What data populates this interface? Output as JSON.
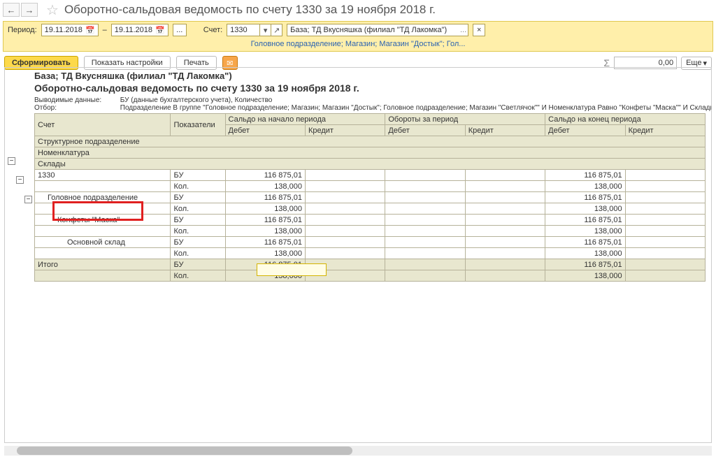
{
  "header": {
    "page_title": "Оборотно-сальдовая ведомость по счету 1330  за 19 ноября 2018 г."
  },
  "filters": {
    "period_label": "Период:",
    "date_from": "19.11.2018",
    "date_to": "19.11.2018",
    "dash": "–",
    "ellipsis": "...",
    "account_label": "Счет:",
    "account_value": "1330",
    "org_value": "База; ТД Вкусняшка (филиал \"ТД Лакомка\")",
    "x": "×",
    "sub_link": "Головное подразделение; Магазин; Магазин \"Достык\"; Гол..."
  },
  "actions": {
    "form": "Сформировать",
    "show_settings": "Показать настройки",
    "print": "Печать",
    "sum_value": "0,00",
    "more": "Еще",
    "more_caret": "▾"
  },
  "report": {
    "org_line": "База; ТД Вкусняшка (филиал \"ТД Лакомка\")",
    "title": "Оборотно-сальдовая ведомость по счету 1330  за 19 ноября 2018 г.",
    "out_label": "Выводимые данные:",
    "out_value": "БУ (данные бухгалтерского учета), Количество",
    "filter_label": "Отбор:",
    "filter_value": "Подразделение В группе \"Головное подразделение; Магазин; Магазин \"Достык\"; Головное подразделение; Магазин \"Светлячок\"\" И Номенклатура Равно \"Конфеты \"Маска\"\" И Склады Равно \"Основн",
    "headers": {
      "account": "Счет",
      "indicators": "Показатели",
      "start_balance": "Сальдо на начало периода",
      "turnover": "Обороты за период",
      "end_balance": "Сальдо на конец периода",
      "debit": "Дебет",
      "credit": "Кредит",
      "struct": "Структурное подразделение",
      "nomen": "Номенклатура",
      "warehouses": "Склады"
    },
    "rowlabels": {
      "r1330": "1330",
      "head_dep": "Головное подразделение",
      "candy": "Конфеты \"Маска\"",
      "main_wh": "Основной склад",
      "total": "Итого",
      "bu": "БУ",
      "kol": "Кол."
    },
    "values": {
      "amount": "116 875,01",
      "qty": "138,000"
    },
    "toggle_minus": "−"
  }
}
